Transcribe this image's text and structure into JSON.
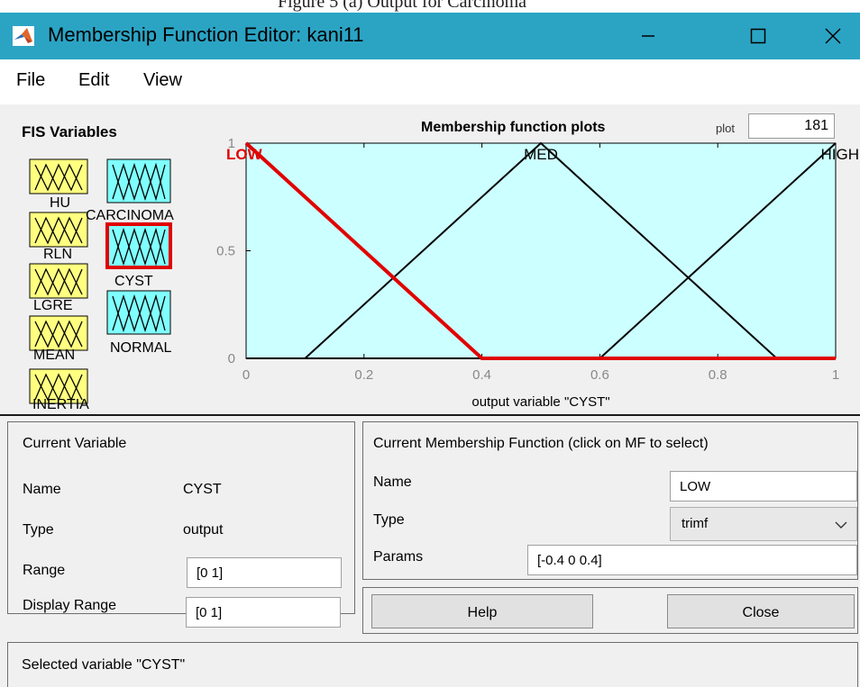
{
  "caption": "Figure 5 (a) Output for Carcinoma",
  "window": {
    "title": "Membership Function Editor: kani11",
    "controls": [
      "minimize",
      "maximize",
      "close"
    ]
  },
  "menu": [
    "File",
    "Edit",
    "View"
  ],
  "fis": {
    "label": "FIS Variables",
    "inputs": [
      "HU",
      "RLN",
      "LGRE",
      "MEAN",
      "INERTIA"
    ],
    "outputs": [
      "CARCINOMA",
      "CYST",
      "NORMAL"
    ],
    "selected": "CYST",
    "colors": {
      "input": "#ffff80",
      "output": "#80ffff",
      "selected_border": "#e00000"
    }
  },
  "plot": {
    "title": "Membership function plots",
    "points_label": "plot",
    "points_value": "181",
    "xlabel": "output variable \"CYST\""
  },
  "chart_data": {
    "type": "line",
    "xlim": [
      0,
      1
    ],
    "ylim": [
      0,
      1
    ],
    "x_ticks": [
      "0",
      "0.2",
      "0.4",
      "0.6",
      "0.8",
      "1"
    ],
    "y_ticks": [
      "0",
      "0.5",
      "1"
    ],
    "background": "#ccffff",
    "series": [
      {
        "name": "LOW",
        "mf": "trimf",
        "params": [
          -0.4,
          0,
          0.4
        ],
        "color": "#e00000",
        "selected": true
      },
      {
        "name": "MED",
        "mf": "trimf",
        "params": [
          0.1,
          0.5,
          0.9
        ],
        "color": "#000000",
        "selected": false
      },
      {
        "name": "HIGH",
        "mf": "trimf",
        "params": [
          0.6,
          1,
          1.4
        ],
        "color": "#000000",
        "selected": false
      }
    ]
  },
  "current_variable": {
    "title": "Current Variable",
    "name_label": "Name",
    "name_value": "CYST",
    "type_label": "Type",
    "type_value": "output",
    "range_label": "Range",
    "range_value": "[0 1]",
    "display_range_label": "Display Range",
    "display_range_value": "[0 1]"
  },
  "current_mf": {
    "title": "Current Membership Function (click on MF to select)",
    "name_label": "Name",
    "name_value": "LOW",
    "type_label": "Type",
    "type_value": "trimf",
    "params_label": "Params",
    "params_value": "[-0.4 0 0.4]"
  },
  "buttons": {
    "help": "Help",
    "close": "Close"
  },
  "status": "Selected variable \"CYST\""
}
